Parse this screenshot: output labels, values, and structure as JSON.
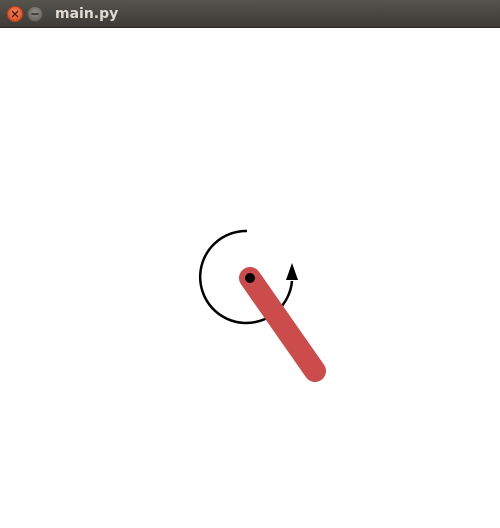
{
  "window": {
    "title": "main.py",
    "close_icon": "close-icon",
    "minimize_icon": "minimize-icon"
  },
  "scene": {
    "pole_color": "#cc4c4c",
    "pivot_color": "#000000",
    "arrow_color": "#000000",
    "background": "#ffffff"
  }
}
